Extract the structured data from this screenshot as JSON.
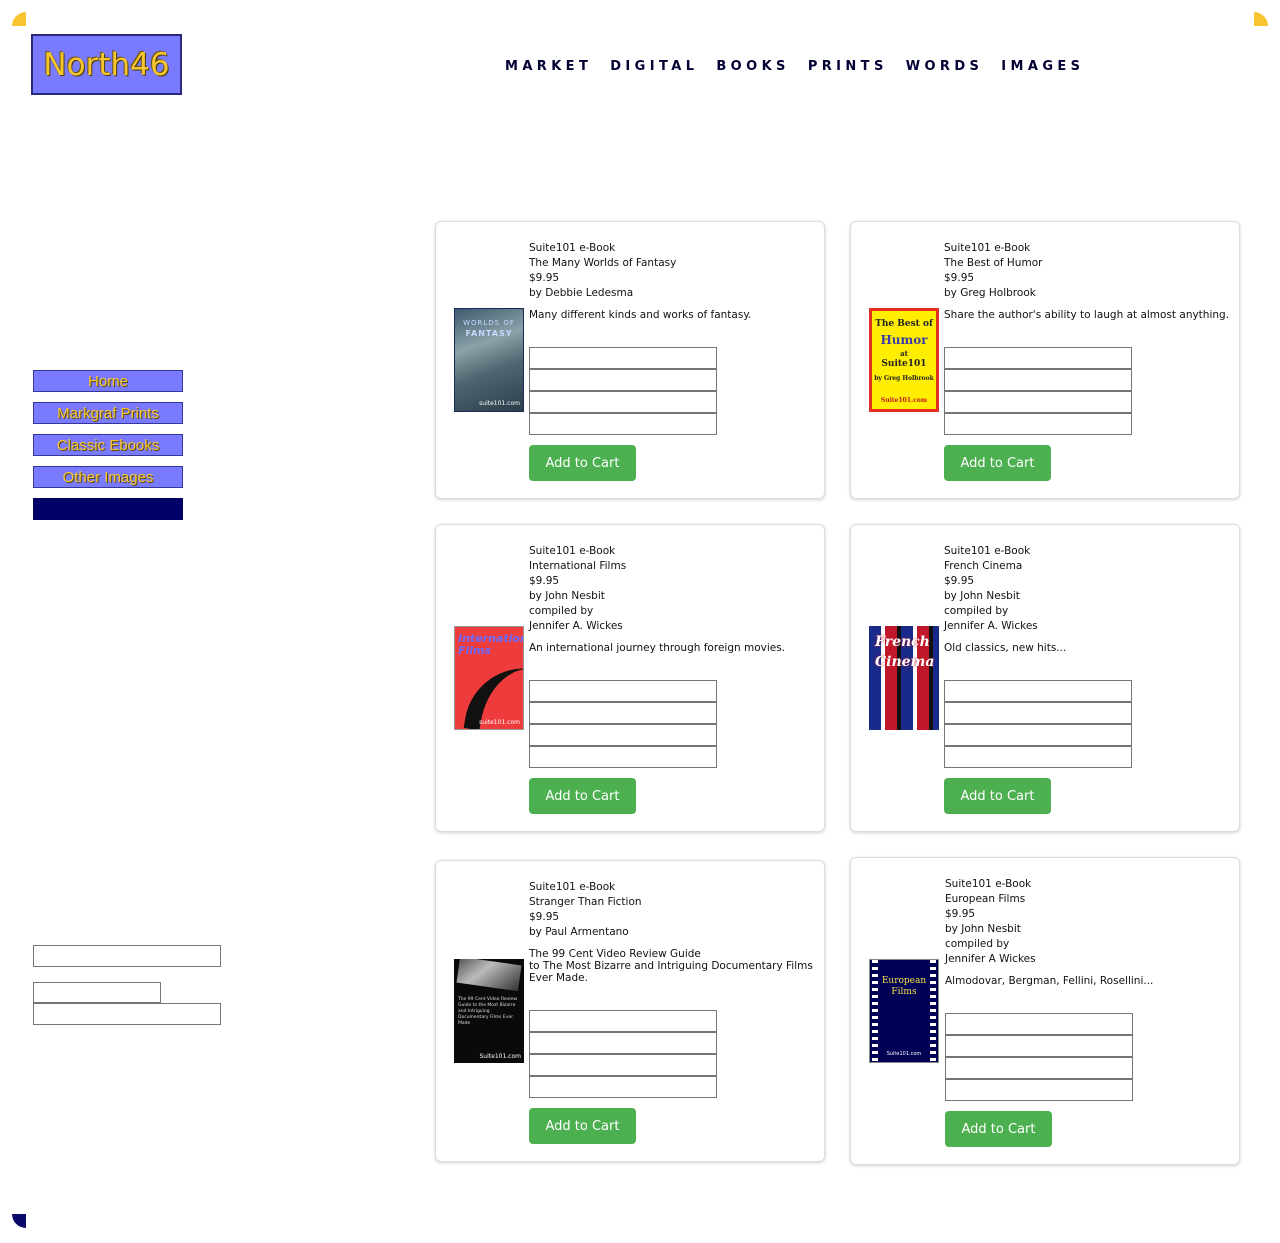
{
  "brand": {
    "logo_text": "North46"
  },
  "top_nav": [
    "MARKET",
    "DIGITAL",
    "BOOKS",
    "PRINTS",
    "WORDS",
    "IMAGES"
  ],
  "side_nav": [
    "Home",
    "Markgraf Prints",
    "Classic Ebooks",
    "Other Images"
  ],
  "colors": {
    "accent": "#7a7aff",
    "gold": "#f7c531",
    "navy": "#000066",
    "button_green": "#4caf50"
  },
  "products": [
    {
      "type": "Suite101 e-Book",
      "title": "The Many Worlds of Fantasy",
      "price": "$9.95",
      "author_lines": [
        "by Debbie Ledesma"
      ],
      "description": "Many different kinds and works of fantasy.",
      "cover": {
        "lines": [
          "WORLDS OF",
          "FANTASY",
          "suite101.com"
        ]
      },
      "button": "Add to Cart"
    },
    {
      "type": "Suite101 e-Book",
      "title": "The Best of Humor",
      "price": "$9.95",
      "author_lines": [
        "by Greg Holbrook"
      ],
      "description": "Share the author's ability to laugh at almost anything.",
      "cover": {
        "lines": [
          "The Best of",
          "Humor",
          "at",
          "Suite101",
          "by Greg Holbrook",
          "Suite101.com"
        ]
      },
      "button": "Add to Cart"
    },
    {
      "type": "Suite101 e-Book",
      "title": "International Films",
      "price": "$9.95",
      "author_lines": [
        "by John Nesbit",
        "compiled by",
        "Jennifer A. Wickes"
      ],
      "description": "An international journey through foreign movies.",
      "cover": {
        "lines": [
          "International",
          "Films",
          "suite101.com"
        ]
      },
      "button": "Add to Cart"
    },
    {
      "type": "Suite101 e-Book",
      "title": "French Cinema",
      "price": "$9.95",
      "author_lines": [
        "by John Nesbit",
        "compiled by",
        "Jennifer A. Wickes"
      ],
      "description": "Old classics, new hits...",
      "cover": {
        "lines": [
          "French",
          "Cinema"
        ]
      },
      "button": "Add to Cart"
    },
    {
      "type": "Suite101 e-Book",
      "title": "Stranger Than Fiction",
      "price": "$9.95",
      "author_lines": [
        "by Paul Armentano"
      ],
      "description": "The 99 Cent Video Review Guide\nto The Most Bizarre and Intriguing Documentary Films\nEver Made.",
      "cover": {
        "lines": [
          "The 99 Cent Video Review Guide to the Most Bizarre and Intriguing Documentary Films Ever Made",
          "Suite101.com"
        ]
      },
      "button": "Add to Cart"
    },
    {
      "type": "Suite101 e-Book",
      "title": "European Films",
      "price": "$9.95",
      "author_lines": [
        "by John Nesbit",
        "compiled by",
        "Jennifer A Wickes"
      ],
      "description": "Almodovar, Bergman, Fellini, Rosellini...",
      "cover": {
        "lines": [
          "European",
          "Films",
          "Suite101.com"
        ]
      },
      "button": "Add to Cart"
    }
  ]
}
